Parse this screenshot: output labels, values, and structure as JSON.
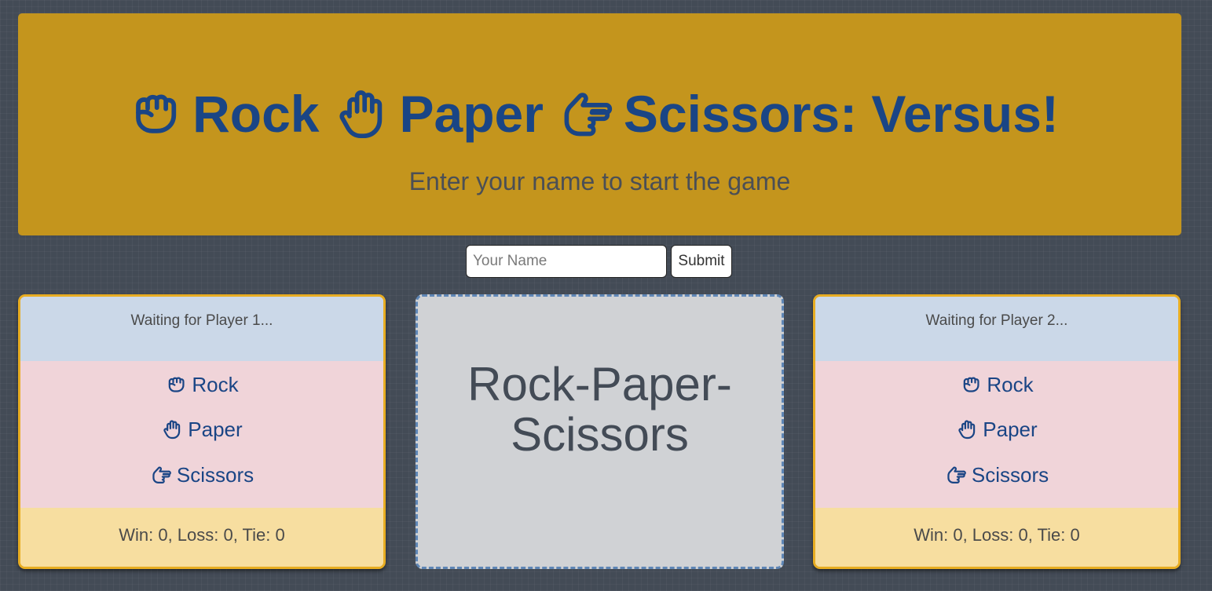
{
  "header": {
    "title_parts": [
      "Rock",
      "Paper",
      "Scissors: Versus!"
    ],
    "subtitle": "Enter your name to start the game",
    "title_color": "#1a4585",
    "background_color": "#c4951d"
  },
  "name_form": {
    "placeholder": "Your Name",
    "value": "",
    "submit_label": "Submit"
  },
  "player1": {
    "status": "Waiting for Player 1...",
    "choices": [
      {
        "icon": "fist-icon",
        "label": "Rock"
      },
      {
        "icon": "open-hand-icon",
        "label": "Paper"
      },
      {
        "icon": "scissors-hand-icon",
        "label": "Scissors"
      }
    ],
    "score": "Win: 0, Loss: 0, Tie: 0"
  },
  "arena": {
    "title": "Rock-Paper-Scissors"
  },
  "player2": {
    "status": "Waiting for Player 2...",
    "choices": [
      {
        "icon": "fist-icon",
        "label": "Rock"
      },
      {
        "icon": "open-hand-icon",
        "label": "Paper"
      },
      {
        "icon": "scissors-hand-icon",
        "label": "Scissors"
      }
    ],
    "score": "Win: 0, Loss: 0, Tie: 0"
  }
}
